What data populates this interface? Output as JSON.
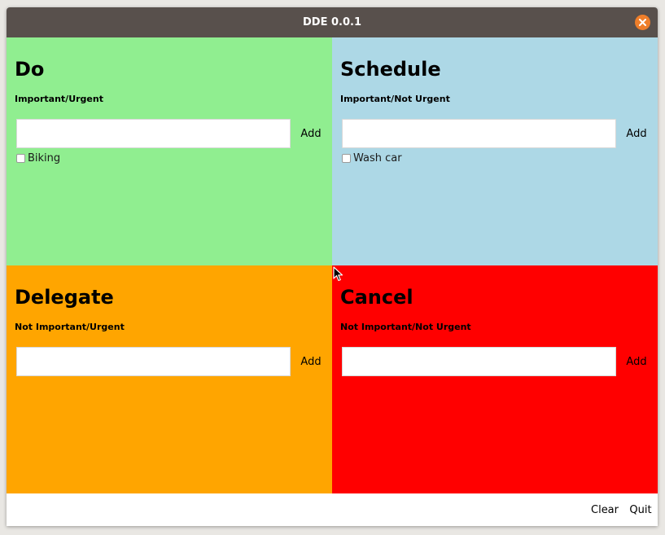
{
  "window": {
    "title": "DDE 0.0.1",
    "close_icon": "close-icon"
  },
  "colors": {
    "titlebar": "#58504c",
    "close_button": "#ee7e2a",
    "do": "#90ee90",
    "schedule": "#add8e6",
    "delegate": "#ffa500",
    "cancel": "#ff0000"
  },
  "quadrants": {
    "do": {
      "heading": "Do",
      "subtitle": "Important/Urgent",
      "input_value": "",
      "add_label": "Add",
      "items": [
        "Biking"
      ]
    },
    "schedule": {
      "heading": "Schedule",
      "subtitle": "Important/Not Urgent",
      "input_value": "",
      "add_label": "Add",
      "items": [
        "Wash car"
      ]
    },
    "delegate": {
      "heading": "Delegate",
      "subtitle": "Not Important/Urgent",
      "input_value": "",
      "add_label": "Add",
      "items": []
    },
    "cancel": {
      "heading": "Cancel",
      "subtitle": "Not Important/Not Urgent",
      "input_value": "",
      "add_label": "Add",
      "items": []
    }
  },
  "footer": {
    "clear_label": "Clear",
    "quit_label": "Quit"
  }
}
